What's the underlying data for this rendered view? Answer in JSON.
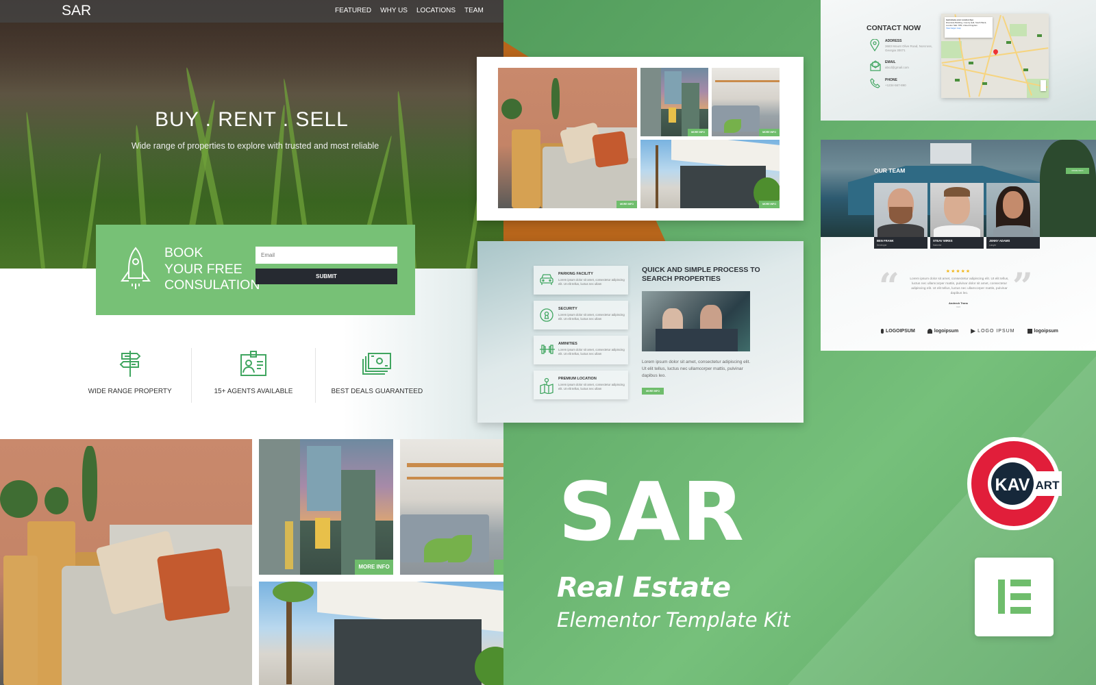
{
  "showcase": {
    "brand_title": "SAR",
    "subtitle": "Real Estate",
    "tagline": "Elementor Template Kit",
    "badge_logo": {
      "left": "KAV",
      "right": "ART"
    },
    "elementor_badge": "elementor-logo"
  },
  "site": {
    "logo": "SAR",
    "nav": [
      "FEATURED",
      "WHY US",
      "LOCATIONS",
      "TEAM"
    ],
    "hero": {
      "title": "BUY . RENT . SELL",
      "subtitle": "Wide range of properties to explore with trusted and most reliable"
    },
    "booking": {
      "line1": "BOOK",
      "line2": "YOUR FREE",
      "line3": "CONSULATION",
      "email_placeholder": "Email",
      "submit_label": "SUBMIT"
    },
    "features": [
      {
        "icon": "signpost-icon",
        "label": "WIDE RANGE PROPERTY"
      },
      {
        "icon": "id-badge-icon",
        "label": "15+ AGENTS AVAILABLE"
      },
      {
        "icon": "cash-stack-icon",
        "label": "BEST DEALS GUARANTEED"
      }
    ],
    "gallery": {
      "more_info_label": "MORE INFO"
    }
  },
  "process": {
    "items": [
      {
        "icon": "car-icon",
        "title": "PARKING FACILITY",
        "desc": "Lorem ipsum dolor sit amet, consectetur adipiscing elit. Ut elit tellus, luctus nec ullam"
      },
      {
        "icon": "keyhole-icon",
        "title": "SECURITY",
        "desc": "Lorem ipsum dolor sit amet, consectetur adipiscing elit. Ut elit tellus, luctus nec ullam"
      },
      {
        "icon": "dumbbell-icon",
        "title": "AMINITIES",
        "desc": "Lorem ipsum dolor sit amet, consectetur adipiscing elit. Ut elit tellus, luctus nec ullam"
      },
      {
        "icon": "map-pin-icon",
        "title": "PREMIUM LOCATION",
        "desc": "Lorem ipsum dolor sit amet, consectetur adipiscing elit. Ut elit tellus, luctus nec ullam"
      }
    ],
    "title_line1": "QUICK AND SIMPLE PROCESS TO",
    "title_line2": "SEARCH PROPERTIES",
    "desc": "Lorem ipsum dolor sit amet, consectetur adipiscing elit. Ut elit tellus, luctus nec ullamcorper mattis, pulvinar dapibus leo.",
    "button_label": "MORE INFO"
  },
  "contact": {
    "title": "CONTACT NOW",
    "address_label": "ADDRESS",
    "address_value": "3683 Mount Olive Road, Norcross, Georgia 30071",
    "email_label": "EMAIL",
    "email_value": "abcd@gmail.com",
    "phone_label": "PHONE",
    "phone_value": "+1234-567-890",
    "map": {
      "place_title": "lastminute.com London Eye",
      "place_address": "Riverside Building, County Hall, South Bank, London SE1 7PB, United Kingdom",
      "directions_label": "Directions",
      "reviews": "1,29,209 reviews",
      "larger_map_label": "View larger map"
    }
  },
  "team": {
    "title": "OUR TEAM",
    "button_label": "MORE INFO",
    "members": [
      {
        "name": "BEN FRANK",
        "role": "Developer"
      },
      {
        "name": "STEAV WIRES",
        "role": "Marketer"
      },
      {
        "name": "JENNY ADAMS",
        "role": "Lawyer"
      }
    ],
    "rating_stars": "★★★★★",
    "rating": 5,
    "testimonial": "Lorem ipsum dolor sit amet, consectetur adipiscing elit. Ut elit tellus, luctus nec ullamcorper mattis, pulvinar dolor sit amet, consectetur adipiscing elit. Ut elit tellus, luctus nec ullamcorper mattis, pulvinar dapibus leo.",
    "author": "Andrech Trans",
    "author_role": "CEO",
    "logos": [
      "LOGOIPSUM",
      "logoipsum",
      "LOGO IPSUM",
      "logoipsum"
    ]
  }
}
